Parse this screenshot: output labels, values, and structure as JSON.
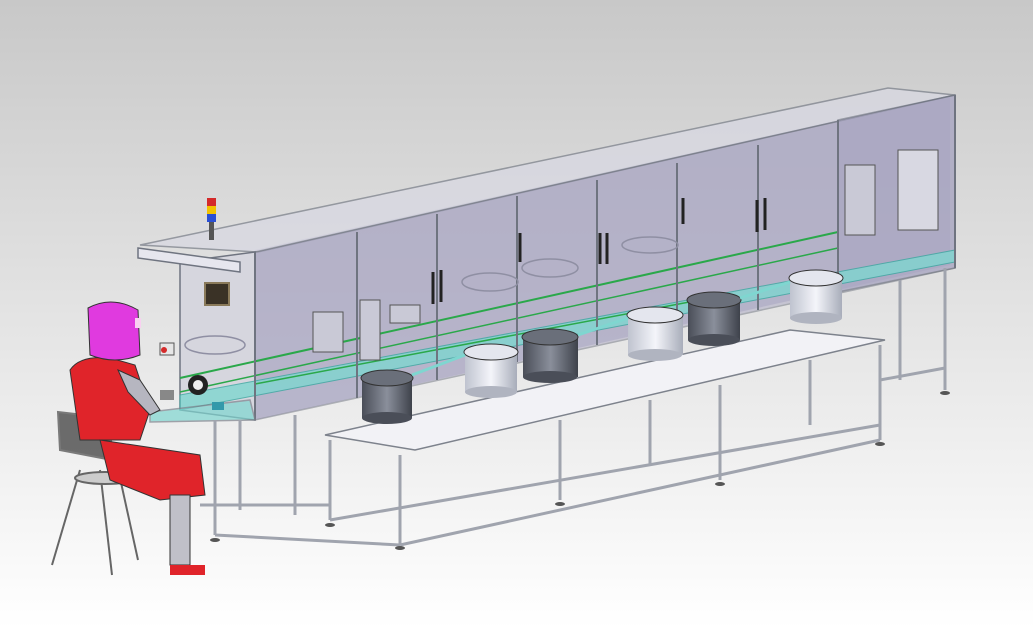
{
  "scene": {
    "kind": "3D CAD rendering",
    "subject": "assembly line",
    "colors": {
      "background_top": "#c8c8c8",
      "background_bottom": "#ffffff",
      "frame": "#b8bcc4",
      "frame_dark": "#7d828c",
      "glass": "#a9a6c2",
      "conveyor": "#7fd6d0",
      "bowl_light": "#e4e6ee",
      "bowl_dark": "#5f6470",
      "operator_suit": "#e0242a",
      "operator_head": "#e03adf",
      "beacon_red": "#d42a2a",
      "beacon_yellow": "#f2c200",
      "beacon_blue": "#2a4fd4"
    }
  }
}
